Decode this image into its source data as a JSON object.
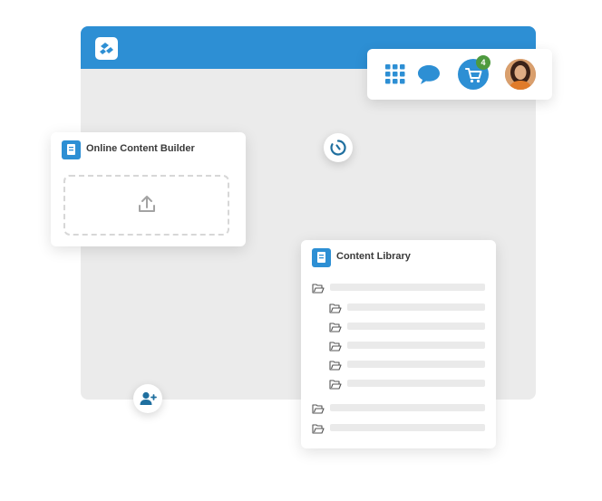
{
  "header": {
    "logo_icon": "app-logo-icon"
  },
  "toolbar": {
    "apps_icon": "apps-grid-icon",
    "chat_icon": "chat-icon",
    "cart_icon": "cart-icon",
    "cart_count": "4",
    "avatar": "user-avatar"
  },
  "builder": {
    "title": "Online Content Builder",
    "upload_icon": "upload-icon"
  },
  "library": {
    "title": "Content Library",
    "tree": [
      {
        "level": 0,
        "icon": "folder-open-icon"
      },
      {
        "level": 1,
        "icon": "folder-open-icon"
      },
      {
        "level": 1,
        "icon": "folder-open-icon"
      },
      {
        "level": 1,
        "icon": "folder-open-icon"
      },
      {
        "level": 1,
        "icon": "folder-open-icon"
      },
      {
        "level": 1,
        "icon": "folder-open-icon"
      },
      {
        "level": 0,
        "icon": "folder-open-icon"
      },
      {
        "level": 0,
        "icon": "folder-open-icon"
      }
    ]
  },
  "floating": {
    "timer_icon": "timer-icon",
    "add_user_icon": "add-user-icon"
  },
  "colors": {
    "brand_blue": "#2d8fd4",
    "canvas_gray": "#ebebeb",
    "badge_green": "#4e9a3f"
  }
}
